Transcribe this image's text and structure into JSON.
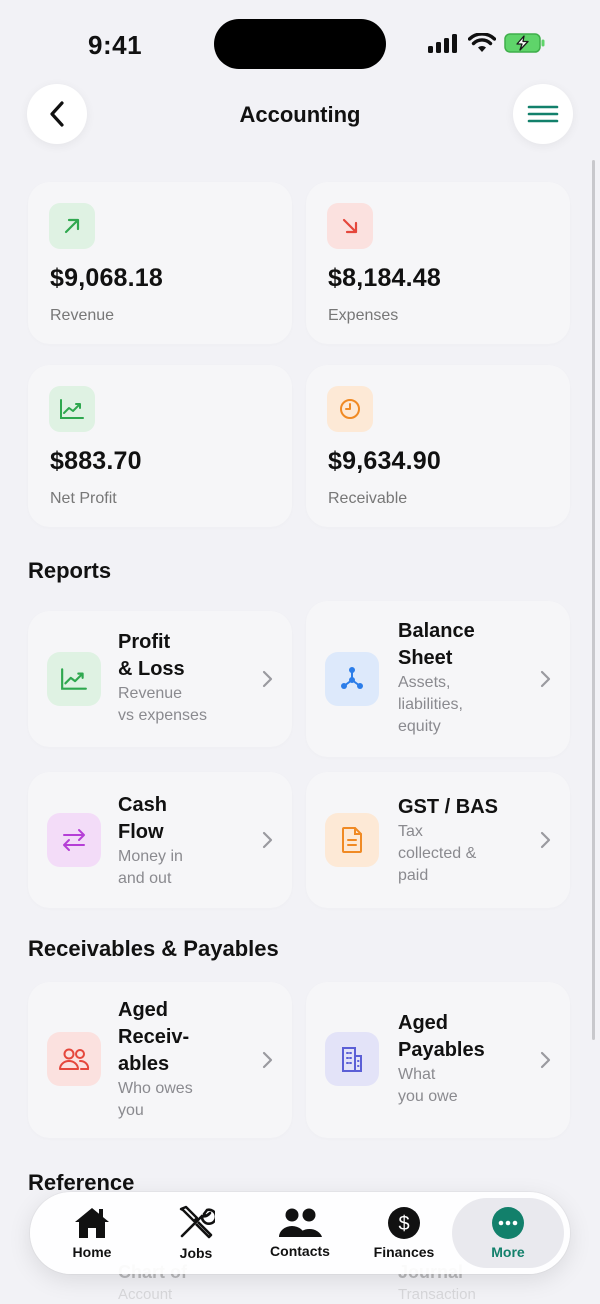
{
  "status_bar": {
    "time": "9:41"
  },
  "header": {
    "title": "Accounting"
  },
  "stats": [
    {
      "value": "$9,068.18",
      "label": "Revenue",
      "icon": "arrow-up-right-icon",
      "color": "#2fa84f",
      "bg": "#dff2e3"
    },
    {
      "value": "$8,184.48",
      "label": "Expenses",
      "icon": "arrow-down-right-icon",
      "color": "#e5473c",
      "bg": "#fbe1df"
    },
    {
      "value": "$883.70",
      "label": "Net Profit",
      "icon": "trend-chart-icon",
      "color": "#2fa84f",
      "bg": "#dff2e3"
    },
    {
      "value": "$9,634.90",
      "label": "Receivable",
      "icon": "clock-icon",
      "color": "#f08a24",
      "bg": "#fde9d6"
    }
  ],
  "reports": {
    "title": "Reports",
    "items": [
      {
        "title": "Profit\n& Loss",
        "subtitle": "Revenue\nvs expenses",
        "icon": "trend-chart-icon",
        "color": "#2fa84f",
        "bg": "#dff2e3"
      },
      {
        "title": "Balance\nSheet",
        "subtitle": "Assets,\nliabilities,\nequity",
        "icon": "nodes-icon",
        "color": "#2b7de9",
        "bg": "#dde9fb"
      },
      {
        "title": "Cash\nFlow",
        "subtitle": "Money in\nand out",
        "icon": "swap-arrows-icon",
        "color": "#b53fd6",
        "bg": "#f3dcf8"
      },
      {
        "title": "GST / BAS",
        "subtitle": "Tax\ncollected &\npaid",
        "icon": "document-icon",
        "color": "#f08a24",
        "bg": "#fde9d6"
      }
    ]
  },
  "receivables": {
    "title": "Receivables & Payables",
    "items": [
      {
        "title": "Aged\nReceiv-\nables",
        "subtitle": "Who owes\nyou",
        "icon": "people-icon",
        "color": "#e5473c",
        "bg": "#fbe1df"
      },
      {
        "title": "Aged\nPayables",
        "subtitle": "What\nyou owe",
        "icon": "building-icon",
        "color": "#5b5fd6",
        "bg": "#e3e3f8"
      }
    ]
  },
  "reference": {
    "title": "Reference",
    "items": [
      {
        "title": "Chart of",
        "subtitle": "Account"
      },
      {
        "title": "Journal",
        "subtitle": "Transaction"
      }
    ]
  },
  "tabbar": {
    "active_color": "#12806b",
    "tabs": [
      {
        "label": "Home",
        "icon": "home-icon"
      },
      {
        "label": "Jobs",
        "icon": "tools-icon"
      },
      {
        "label": "Contacts",
        "icon": "people-icon"
      },
      {
        "label": "Finances",
        "icon": "dollar-icon"
      },
      {
        "label": "More",
        "icon": "more-icon",
        "active": true
      }
    ]
  }
}
